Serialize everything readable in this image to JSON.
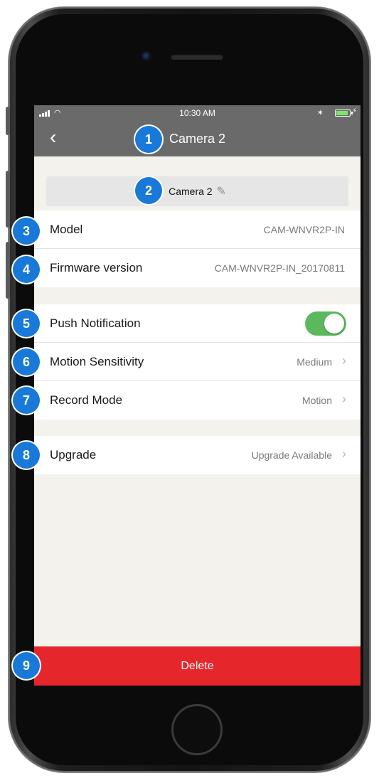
{
  "status_bar": {
    "time": "10:30 AM"
  },
  "nav": {
    "back_icon": "chevron-left-icon",
    "title": "Camera 2"
  },
  "camera_name": {
    "value": "Camera 2",
    "edit_icon": "pencil-icon"
  },
  "info_rows": [
    {
      "label": "Model",
      "value": "CAM-WNVR2P-IN"
    },
    {
      "label": "Firmware version",
      "value": "CAM-WNVR2P-IN_20170811"
    }
  ],
  "settings_rows": {
    "push": {
      "label": "Push Notification",
      "enabled": true
    },
    "motion": {
      "label": "Motion Sensitivity",
      "value": "Medium"
    },
    "record": {
      "label": "Record Mode",
      "value": "Motion"
    }
  },
  "upgrade": {
    "label": "Upgrade",
    "value": "Upgrade Available"
  },
  "delete_label": "Delete",
  "callouts": [
    "1",
    "2",
    "3",
    "4",
    "5",
    "6",
    "7",
    "8",
    "9"
  ],
  "colors": {
    "nav_bg": "#6a6a6a",
    "screen_bg": "#f4f2ec",
    "toggle_on": "#5cb85c",
    "delete_bg": "#e5262a",
    "callout": "#1879d8"
  }
}
